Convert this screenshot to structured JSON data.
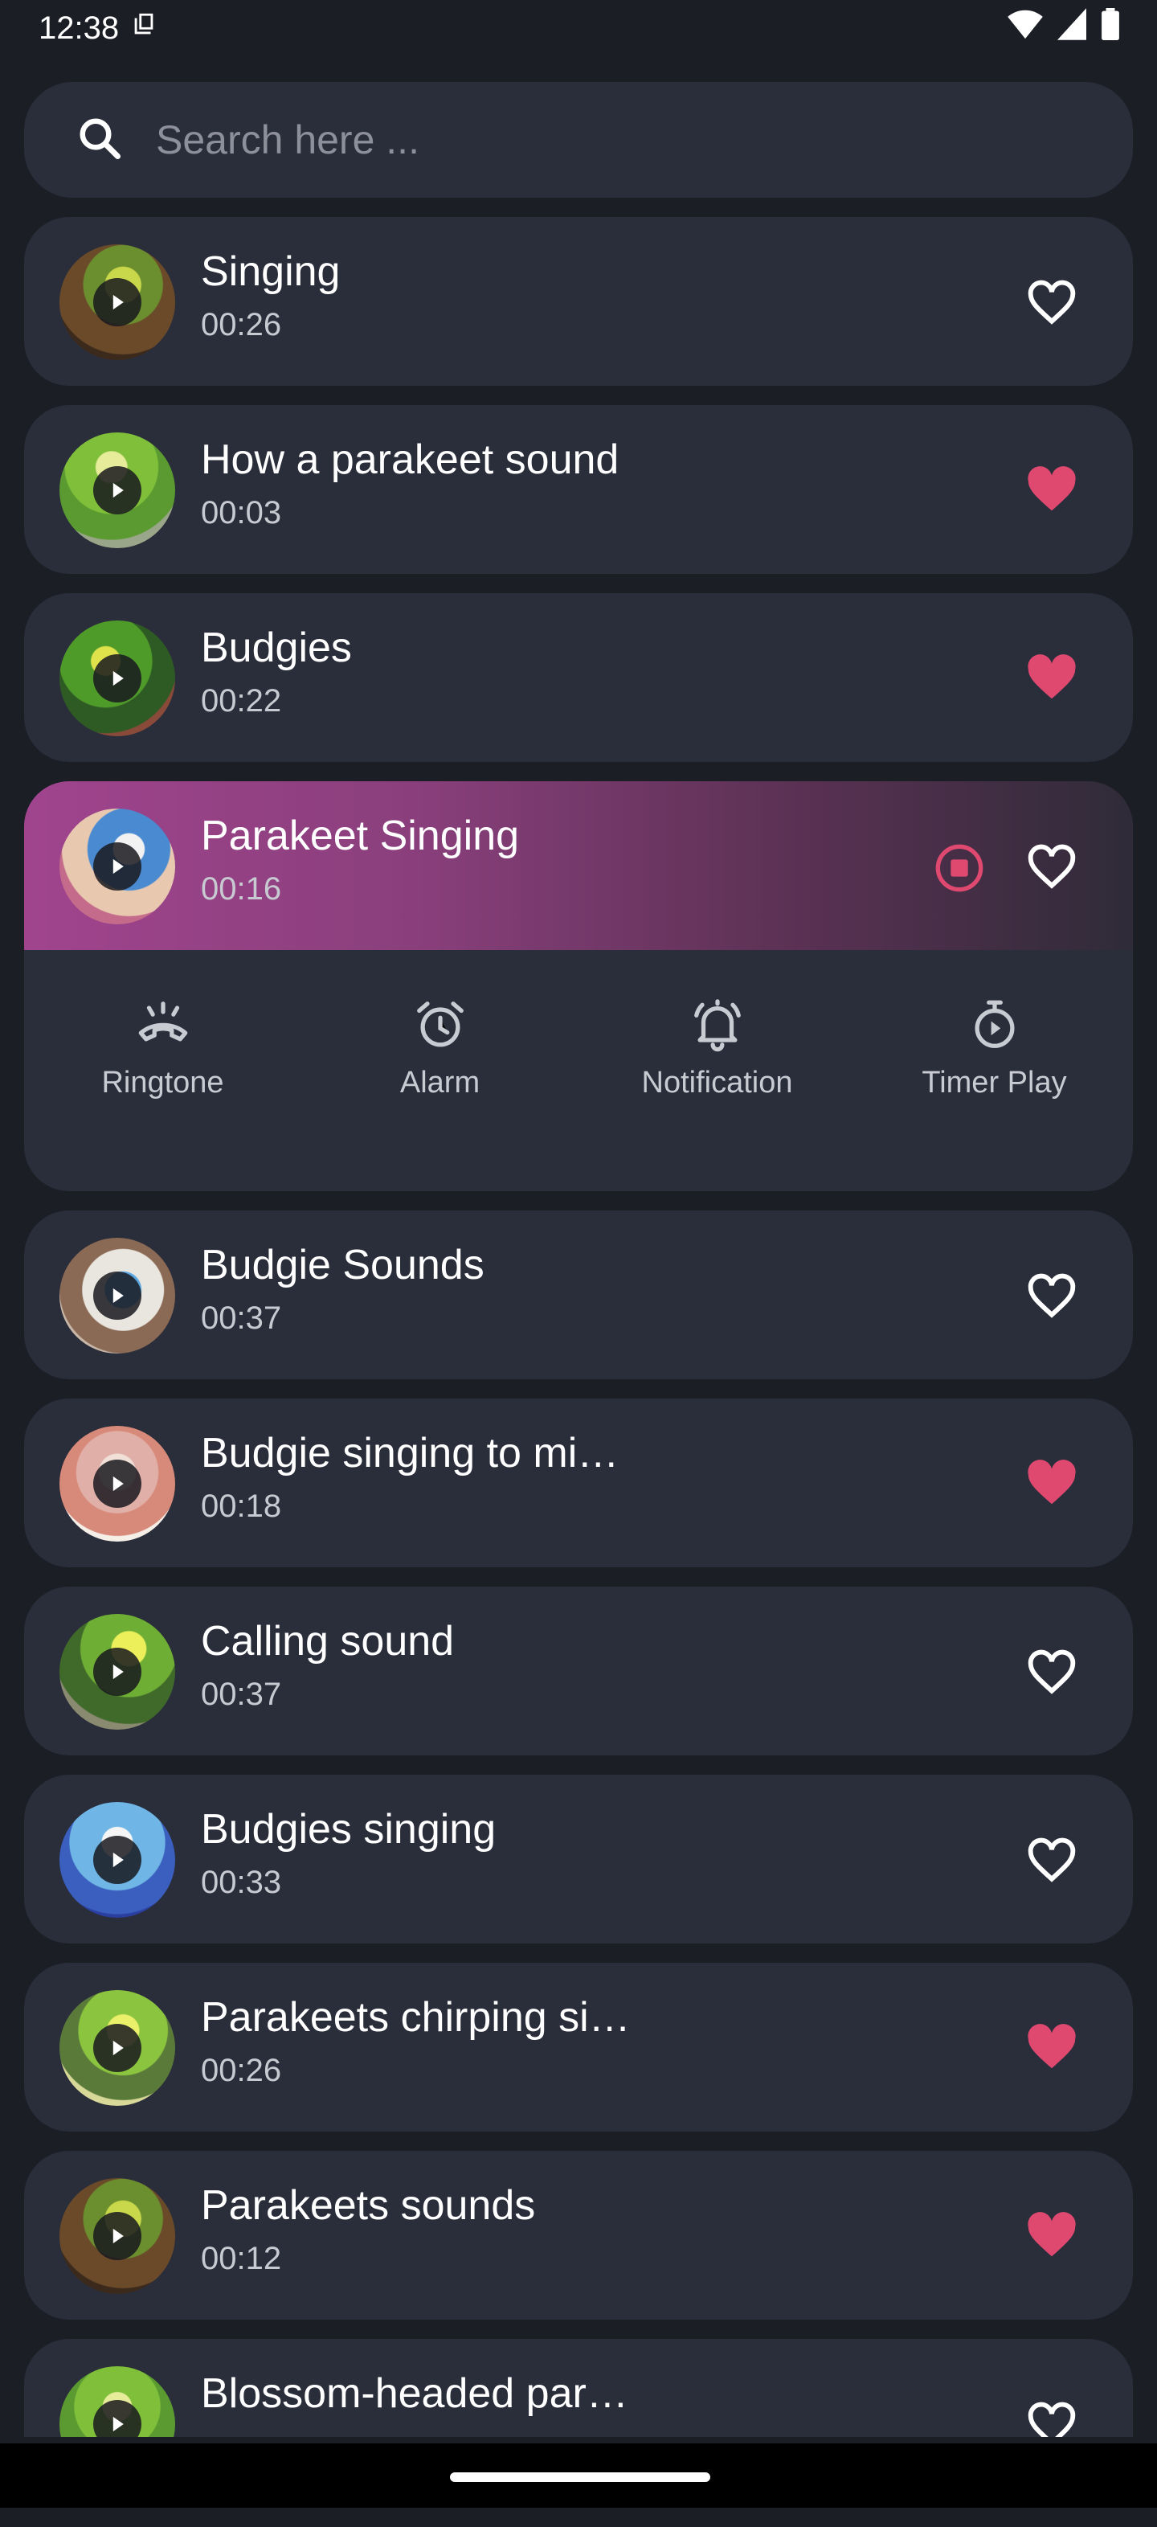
{
  "status_bar": {
    "time": "12:38"
  },
  "search": {
    "placeholder": "Search here ..."
  },
  "colors": {
    "accent": "#e0496f",
    "card": "#2a2d3a",
    "background": "#1c1e26"
  },
  "sounds": [
    {
      "title": "Singing",
      "duration": "00:26",
      "favorite": false
    },
    {
      "title": "How a parakeet sound",
      "duration": "00:03",
      "favorite": true
    },
    {
      "title": "Budgies",
      "duration": "00:22",
      "favorite": true
    },
    {
      "title": "Parakeet Singing",
      "duration": "00:16",
      "favorite": false,
      "playing": true
    },
    {
      "title": "Budgie Sounds",
      "duration": "00:37",
      "favorite": false
    },
    {
      "title": "Budgie singing to mi…",
      "duration": "00:18",
      "favorite": true
    },
    {
      "title": "Calling sound",
      "duration": "00:37",
      "favorite": false
    },
    {
      "title": "Budgies singing",
      "duration": "00:33",
      "favorite": false
    },
    {
      "title": "Parakeets chirping si…",
      "duration": "00:26",
      "favorite": true
    },
    {
      "title": "Parakeets sounds",
      "duration": "00:12",
      "favorite": true
    },
    {
      "title": "Blossom-headed par…",
      "duration": "",
      "favorite": false
    }
  ],
  "actions": {
    "ringtone": "Ringtone",
    "alarm": "Alarm",
    "notification": "Notification",
    "timer_play": "Timer Play"
  },
  "icons": {
    "search": "search-icon",
    "play": "play-icon",
    "heart_outline": "heart-outline-icon",
    "heart_filled": "heart-filled-icon",
    "stop": "stop-icon",
    "ringtone": "phone-ring-icon",
    "alarm": "alarm-clock-icon",
    "notification": "bell-icon",
    "timer": "timer-icon"
  }
}
